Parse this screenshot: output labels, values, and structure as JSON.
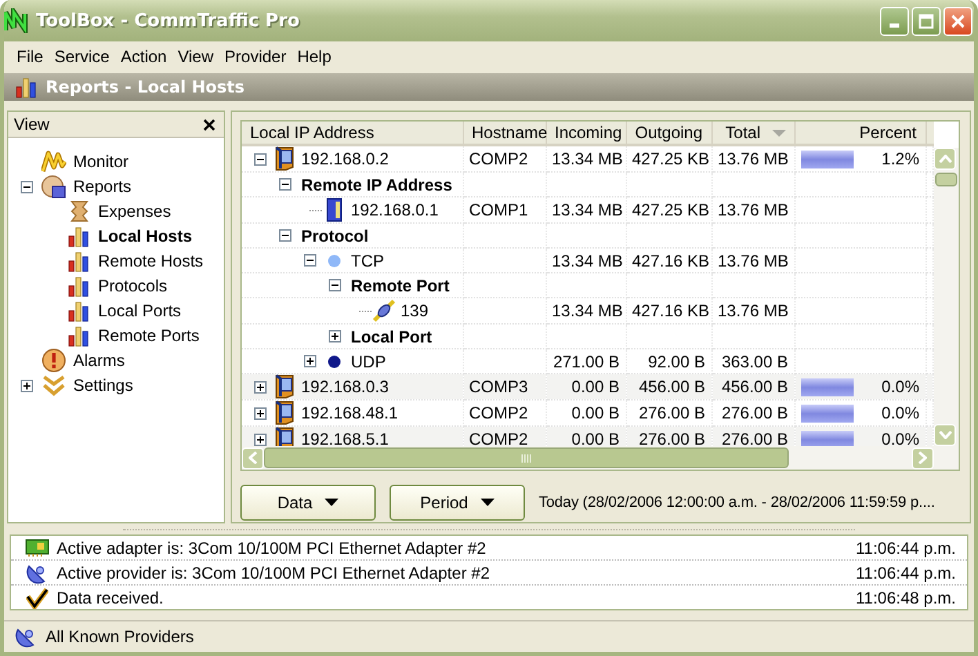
{
  "window": {
    "title": "ToolBox - CommTraffic Pro"
  },
  "menu": [
    "File",
    "Service",
    "Action",
    "View",
    "Provider",
    "Help"
  ],
  "section_header": "Reports - Local Hosts",
  "sidebar": {
    "title": "View",
    "items": [
      {
        "label": "Monitor",
        "kind": "monitor",
        "selected": false
      },
      {
        "label": "Reports",
        "kind": "reports",
        "selected": false,
        "expanded": true,
        "children": [
          {
            "label": "Expenses",
            "kind": "expenses",
            "selected": false
          },
          {
            "label": "Local Hosts",
            "kind": "chart",
            "selected": true
          },
          {
            "label": "Remote Hosts",
            "kind": "chart",
            "selected": false
          },
          {
            "label": "Protocols",
            "kind": "chart",
            "selected": false
          },
          {
            "label": "Local Ports",
            "kind": "chart",
            "selected": false
          },
          {
            "label": "Remote Ports",
            "kind": "chart",
            "selected": false
          }
        ]
      },
      {
        "label": "Alarms",
        "kind": "alarm",
        "selected": false
      },
      {
        "label": "Settings",
        "kind": "settings",
        "selected": false,
        "expanded": false
      }
    ]
  },
  "grid": {
    "columns": [
      {
        "label": "Local IP Address",
        "sorted": false
      },
      {
        "label": "Hostname",
        "sorted": false
      },
      {
        "label": "Incoming",
        "sorted": false
      },
      {
        "label": "Outgoing",
        "sorted": false
      },
      {
        "label": "Total",
        "sorted": true
      },
      {
        "label": "Percent",
        "sorted": false
      }
    ],
    "rows": [
      {
        "kind": "host",
        "label": "192.168.0.2",
        "hostname": "COMP2",
        "incoming": "13.34 MB",
        "outgoing": "427.25 KB",
        "total": "13.76 MB",
        "level": 1,
        "percent": "1.2%",
        "expanded": true,
        "children": [
          {
            "kind": "group",
            "label": "Remote IP Address",
            "expanded": true,
            "children": [
              {
                "kind": "remote-host",
                "label": "192.168.0.1",
                "hostname": "COMP1",
                "incoming": "13.34 MB",
                "outgoing": "427.25 KB",
                "total": "13.76 MB"
              }
            ]
          },
          {
            "kind": "group",
            "label": "Protocol",
            "expanded": true,
            "children": [
              {
                "kind": "protocol",
                "label": "TCP",
                "color": "#8fb8f8",
                "incoming": "13.34 MB",
                "outgoing": "427.16 KB",
                "total": "13.76 MB",
                "expanded": true,
                "children": [
                  {
                    "kind": "group",
                    "label": "Remote Port",
                    "expanded": true,
                    "children": [
                      {
                        "kind": "port",
                        "label": "139",
                        "incoming": "13.34 MB",
                        "outgoing": "427.16 KB",
                        "total": "13.76 MB"
                      }
                    ]
                  },
                  {
                    "kind": "group",
                    "label": "Local Port",
                    "expanded": false
                  }
                ]
              },
              {
                "kind": "protocol",
                "label": "UDP",
                "color": "#10188a",
                "incoming": "271.00 B",
                "outgoing": "92.00 B",
                "total": "363.00 B",
                "expanded": false
              }
            ]
          }
        ]
      },
      {
        "kind": "host",
        "label": "192.168.0.3",
        "hostname": "COMP3",
        "incoming": "0.00 B",
        "outgoing": "456.00 B",
        "total": "456.00 B",
        "level": 1,
        "percent": "0.0%",
        "expanded": false
      },
      {
        "kind": "host",
        "label": "192.168.48.1",
        "hostname": "COMP2",
        "incoming": "0.00 B",
        "outgoing": "276.00 B",
        "total": "276.00 B",
        "level": 1,
        "percent": "0.0%",
        "expanded": false
      },
      {
        "kind": "host",
        "label": "192.168.5.1",
        "hostname": "COMP2",
        "incoming": "0.00 B",
        "outgoing": "276.00 B",
        "total": "276.00 B",
        "level": 1,
        "percent": "0.0%",
        "expanded": false
      }
    ]
  },
  "buttons": [
    "Data",
    "Period"
  ],
  "period_text": "Today (28/02/2006 12:00:00 a.m. - 28/02/2006 11:59:59 p....",
  "log": [
    {
      "kind": "adapter",
      "message": "Active adapter is: 3Com 10/100M PCI Ethernet Adapter #2",
      "time": "11:06:44 p.m."
    },
    {
      "kind": "provider",
      "message": "Active provider is: 3Com 10/100M PCI Ethernet Adapter #2",
      "time": "11:06:44 p.m."
    },
    {
      "kind": "received",
      "message": "Data received.",
      "time": "11:06:48 p.m."
    }
  ],
  "status_bar": {
    "kind": "provider",
    "text": "All Known Providers"
  }
}
